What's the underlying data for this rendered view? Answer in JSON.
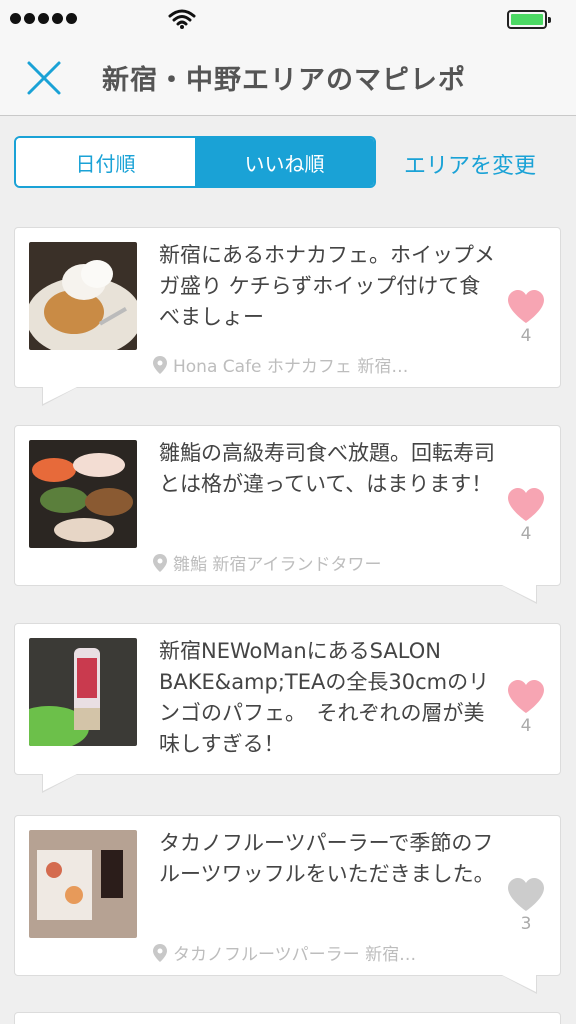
{
  "status_bar": {
    "colors": {
      "battery": "#4cd964"
    }
  },
  "header": {
    "title": "新宿・中野エリアのマピレポ",
    "close_icon": "close-icon"
  },
  "sort": {
    "options": [
      "日付順",
      "いいね順"
    ],
    "selected": "いいね順",
    "change_area_label": "エリアを変更"
  },
  "colors": {
    "accent": "#1aa2d6",
    "like_active": "#f7a5b3",
    "like_inactive": "#cccccc"
  },
  "posts": [
    {
      "text": "新宿にあるホナカフェ。ホイップメガ盛り ケチらずホイップ付けて食べましょー",
      "location": "Hona Cafe ホナカフェ 新宿…",
      "likes": "4",
      "liked": true
    },
    {
      "text": "雛鮨の高級寿司食べ放題。回転寿司とは格が違っていて、はまります！",
      "location": "雛鮨 新宿アイランドタワー",
      "likes": "4",
      "liked": true
    },
    {
      "text": "新宿NEWoManにあるSALON BAKE&amp;TEAの全長30cmのリンゴのパフェ。　それぞれの層が美味しすぎる！",
      "location": "",
      "likes": "4",
      "liked": true
    },
    {
      "text": "タカノフルーツパーラーで季節のフルーツワッフルをいただきました。",
      "location": "タカノフルーツパーラー 新宿…",
      "likes": "3",
      "liked": false
    }
  ]
}
